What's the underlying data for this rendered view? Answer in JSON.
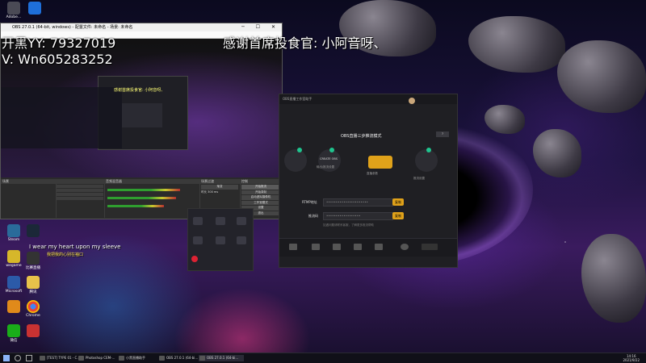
{
  "overlay": {
    "line1": "开黑YY:  79327019",
    "line2": "V: Wn605283252",
    "thanks": "感谢首席投食官: 小阿音呀、",
    "lyric_en": "I wear my heart upon my sleeve",
    "lyric_cn": "我把我的心别在袖口"
  },
  "obs": {
    "title": "OBS 27.0.1 (64-bit, windows) - 配置文件: 未命名 - 场景: 未命名",
    "scene_header": "场景",
    "mixer_header": "音频混音器",
    "transition_header": "场景过渡",
    "controls_header": "控制",
    "controls": [
      "开始推流",
      "开始录制",
      "启动虚拟摄像机",
      "工作室模式",
      "设置",
      "退出"
    ],
    "fade_label": "渐变",
    "duration_label": "时长",
    "duration_value": "300 ms"
  },
  "assistant": {
    "title": "OBS直播工作室助手",
    "mode_label": "OBS直播三步推流模式",
    "step1": "CREATE OBS",
    "step1_label": "输出/推流设置",
    "step2_label": "直播参数",
    "step3_label": "推流设置",
    "rtmp_label": "RTMP地址",
    "key_label": "推流码",
    "copy_label": "复制",
    "hint": "如遇问题请联系客服，了解更多推流帮助"
  },
  "taskbar": {
    "items": [
      "[TEST] TYPE 01 - C…",
      "Photoshop CEM-…",
      "小黑直播助手",
      "OBS 27.0.1 (64-bi…",
      "OBS 27.0.1 (64-bi…"
    ],
    "time": "14:16",
    "date": "2021/9/22"
  },
  "desktop_icons": [
    "Adobe…",
    "Steam",
    "wegame",
    "比赛直播",
    "Microsoft",
    "腾讯",
    "Chrome",
    "微信"
  ],
  "colors": {
    "accent": "#e0a21a",
    "ok": "#1fc48e"
  }
}
